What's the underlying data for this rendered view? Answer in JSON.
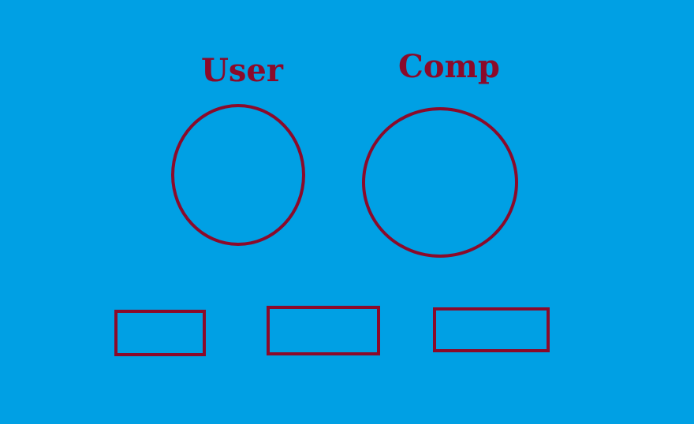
{
  "theme": {
    "background": "#00a0e4",
    "accent": "#8b0a2a"
  },
  "players": {
    "user": {
      "label": "User"
    },
    "computer": {
      "label": "Comp"
    }
  },
  "choices": [
    {
      "id": "choice-1",
      "label": ""
    },
    {
      "id": "choice-2",
      "label": ""
    },
    {
      "id": "choice-3",
      "label": ""
    }
  ]
}
